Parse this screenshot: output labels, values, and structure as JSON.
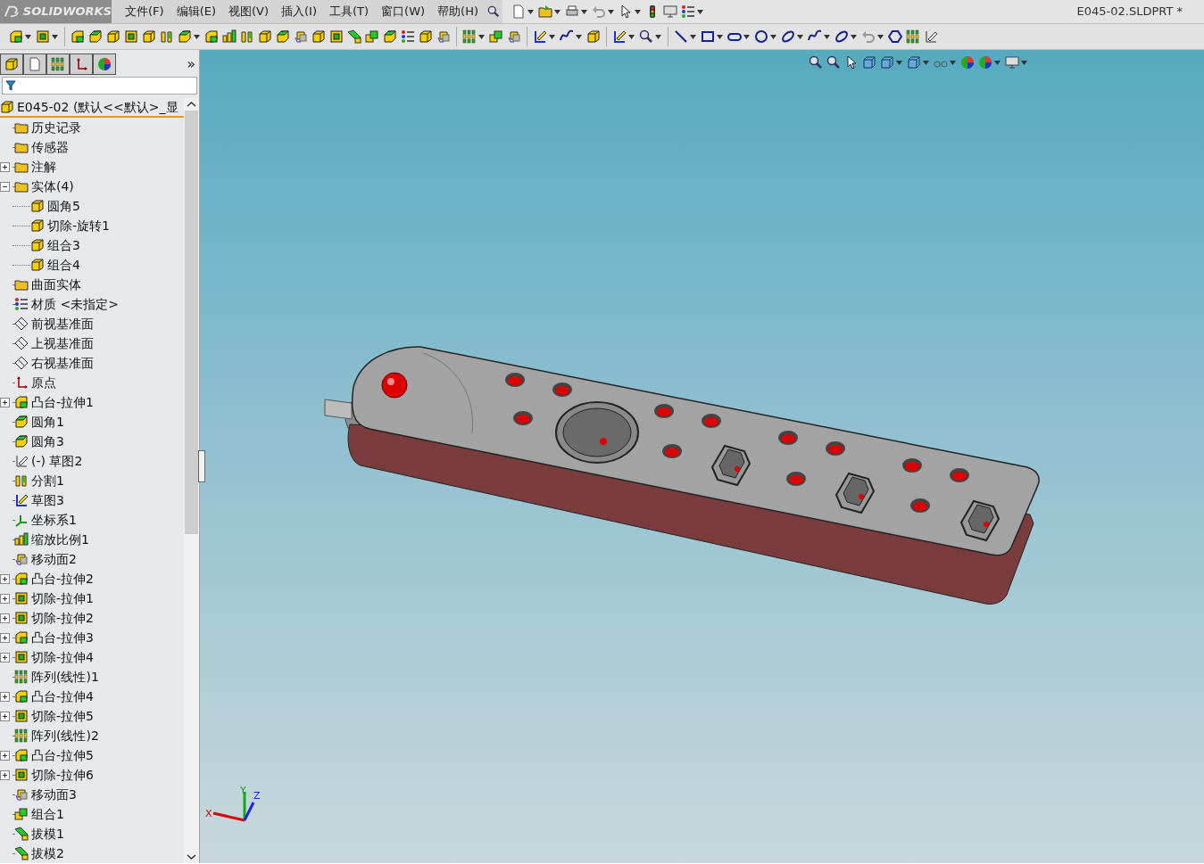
{
  "app": {
    "logo": "SOLIDWORKS"
  },
  "menu": [
    "文件(F)",
    "编辑(E)",
    "视图(V)",
    "插入(I)",
    "工具(T)",
    "窗口(W)",
    "帮助(H)"
  ],
  "document_title": "E045-02.SLDPRT *",
  "panel_more": "»",
  "tree": {
    "root": "E045-02  (默认<<默认>_显",
    "items": [
      {
        "label": "历史记录",
        "kind": "history"
      },
      {
        "label": "传感器",
        "kind": "sensor"
      },
      {
        "label": "注解",
        "kind": "annotation",
        "expanded": false
      },
      {
        "label": "实体(4)",
        "kind": "bodies",
        "expanded": true,
        "children": [
          {
            "label": "圆角5",
            "kind": "body"
          },
          {
            "label": "切除-旋转1",
            "kind": "body"
          },
          {
            "label": "组合3",
            "kind": "body"
          },
          {
            "label": "组合4",
            "kind": "body"
          }
        ]
      },
      {
        "label": "曲面实体",
        "kind": "surface"
      },
      {
        "label": "材质 <未指定>",
        "kind": "material"
      },
      {
        "label": "前视基准面",
        "kind": "plane"
      },
      {
        "label": "上视基准面",
        "kind": "plane"
      },
      {
        "label": "右视基准面",
        "kind": "plane"
      },
      {
        "label": "原点",
        "kind": "origin"
      },
      {
        "label": "凸台-拉伸1",
        "kind": "boss",
        "expanded": false
      },
      {
        "label": "圆角1",
        "kind": "fillet"
      },
      {
        "label": "圆角3",
        "kind": "fillet"
      },
      {
        "label": "(-) 草图2",
        "kind": "sketch"
      },
      {
        "label": "分割1",
        "kind": "split"
      },
      {
        "label": "草图3",
        "kind": "sketch3d"
      },
      {
        "label": "坐标系1",
        "kind": "coords"
      },
      {
        "label": "缩放比例1",
        "kind": "scale"
      },
      {
        "label": "移动面2",
        "kind": "moveface"
      },
      {
        "label": "凸台-拉伸2",
        "kind": "boss",
        "expanded": false
      },
      {
        "label": "切除-拉伸1",
        "kind": "cut",
        "expanded": false
      },
      {
        "label": "切除-拉伸2",
        "kind": "cut",
        "expanded": false
      },
      {
        "label": "凸台-拉伸3",
        "kind": "boss",
        "expanded": false
      },
      {
        "label": "切除-拉伸4",
        "kind": "cut",
        "expanded": false
      },
      {
        "label": "阵列(线性)1",
        "kind": "pattern"
      },
      {
        "label": "凸台-拉伸4",
        "kind": "boss",
        "expanded": false
      },
      {
        "label": "切除-拉伸5",
        "kind": "cut",
        "expanded": false
      },
      {
        "label": "阵列(线性)2",
        "kind": "pattern"
      },
      {
        "label": "凸台-拉伸5",
        "kind": "boss",
        "expanded": false
      },
      {
        "label": "切除-拉伸6",
        "kind": "cut",
        "expanded": false
      },
      {
        "label": "移动面3",
        "kind": "moveface"
      },
      {
        "label": "组合1",
        "kind": "combine"
      },
      {
        "label": "拔模1",
        "kind": "draft"
      },
      {
        "label": "拔模2",
        "kind": "draft"
      }
    ]
  },
  "triad": {
    "labels": [
      "X",
      "Y",
      "Z"
    ]
  }
}
